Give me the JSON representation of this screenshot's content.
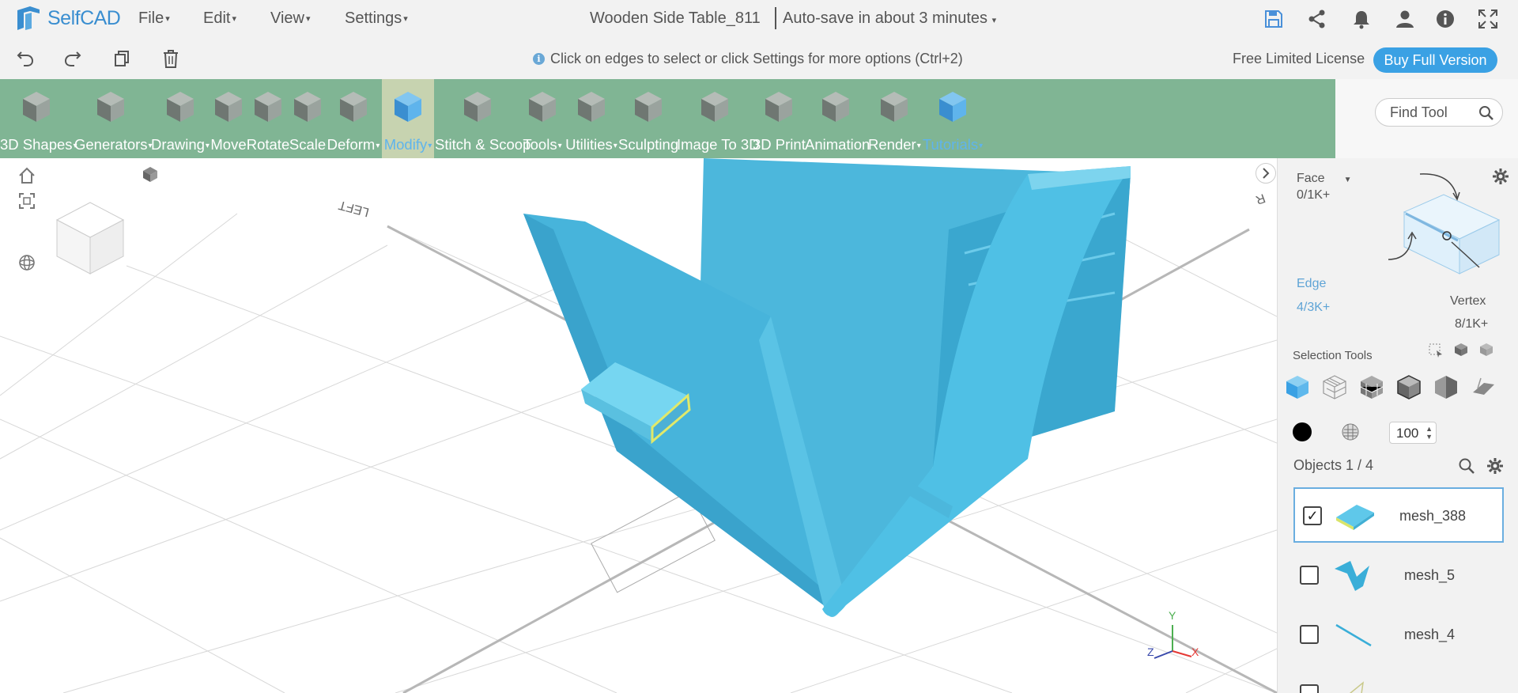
{
  "app": {
    "name": "SelfCAD"
  },
  "menus": [
    {
      "label": "File"
    },
    {
      "label": "Edit"
    },
    {
      "label": "View"
    },
    {
      "label": "Settings"
    }
  ],
  "document": {
    "title": "Wooden Side Table_811",
    "autosave": "Auto-save in about 3 minutes"
  },
  "top_icons": [
    "save-icon",
    "share-icon",
    "bell-icon",
    "user-icon",
    "info-icon",
    "fullscreen-icon"
  ],
  "subbar": {
    "hint": "Click on edges to select or click Settings for more options (Ctrl+2)",
    "license": "Free Limited License",
    "buy_label": "Buy Full Version"
  },
  "toolbar": {
    "tools": [
      {
        "label": "3D Shapes",
        "dropdown": true
      },
      {
        "label": "Generators",
        "dropdown": true
      },
      {
        "label": "Drawing",
        "dropdown": true
      },
      {
        "label": "Move",
        "dropdown": false
      },
      {
        "label": "Rotate",
        "dropdown": false
      },
      {
        "label": "Scale",
        "dropdown": false
      },
      {
        "label": "Deform",
        "dropdown": true
      },
      {
        "label": "Modify",
        "dropdown": true,
        "active": true
      },
      {
        "label": "Stitch & Scoop",
        "dropdown": false
      },
      {
        "label": "Tools",
        "dropdown": true
      },
      {
        "label": "Utilities",
        "dropdown": true
      },
      {
        "label": "Sculpting",
        "dropdown": false
      },
      {
        "label": "Image To 3D",
        "dropdown": false
      },
      {
        "label": "3D Print",
        "dropdown": false
      },
      {
        "label": "Animation",
        "dropdown": false
      },
      {
        "label": "Render",
        "dropdown": true
      },
      {
        "label": "Tutorials",
        "dropdown": true
      }
    ],
    "find_placeholder": "Find Tool"
  },
  "viewport": {
    "scene_labels": {
      "left": "LEFT",
      "right": "R"
    },
    "axis_labels": {
      "x": "X",
      "y": "Y",
      "z": "Z"
    }
  },
  "panel": {
    "selection_mode": "Face",
    "counts": {
      "face": "0/1K+",
      "edge_label": "Edge",
      "edge": "4/3K+",
      "vertex_label": "Vertex",
      "vertex": "8/1K+"
    },
    "selection_tools_label": "Selection Tools",
    "opacity": "100",
    "objects_title": "Objects 1 / 4",
    "objects": [
      {
        "name": "mesh_388",
        "checked": true
      },
      {
        "name": "mesh_5",
        "checked": false
      },
      {
        "name": "mesh_4",
        "checked": false
      }
    ]
  },
  "colors": {
    "toolbar_bg": "#80b594",
    "accent": "#3aa1e4",
    "model": "#4cbfe3"
  }
}
